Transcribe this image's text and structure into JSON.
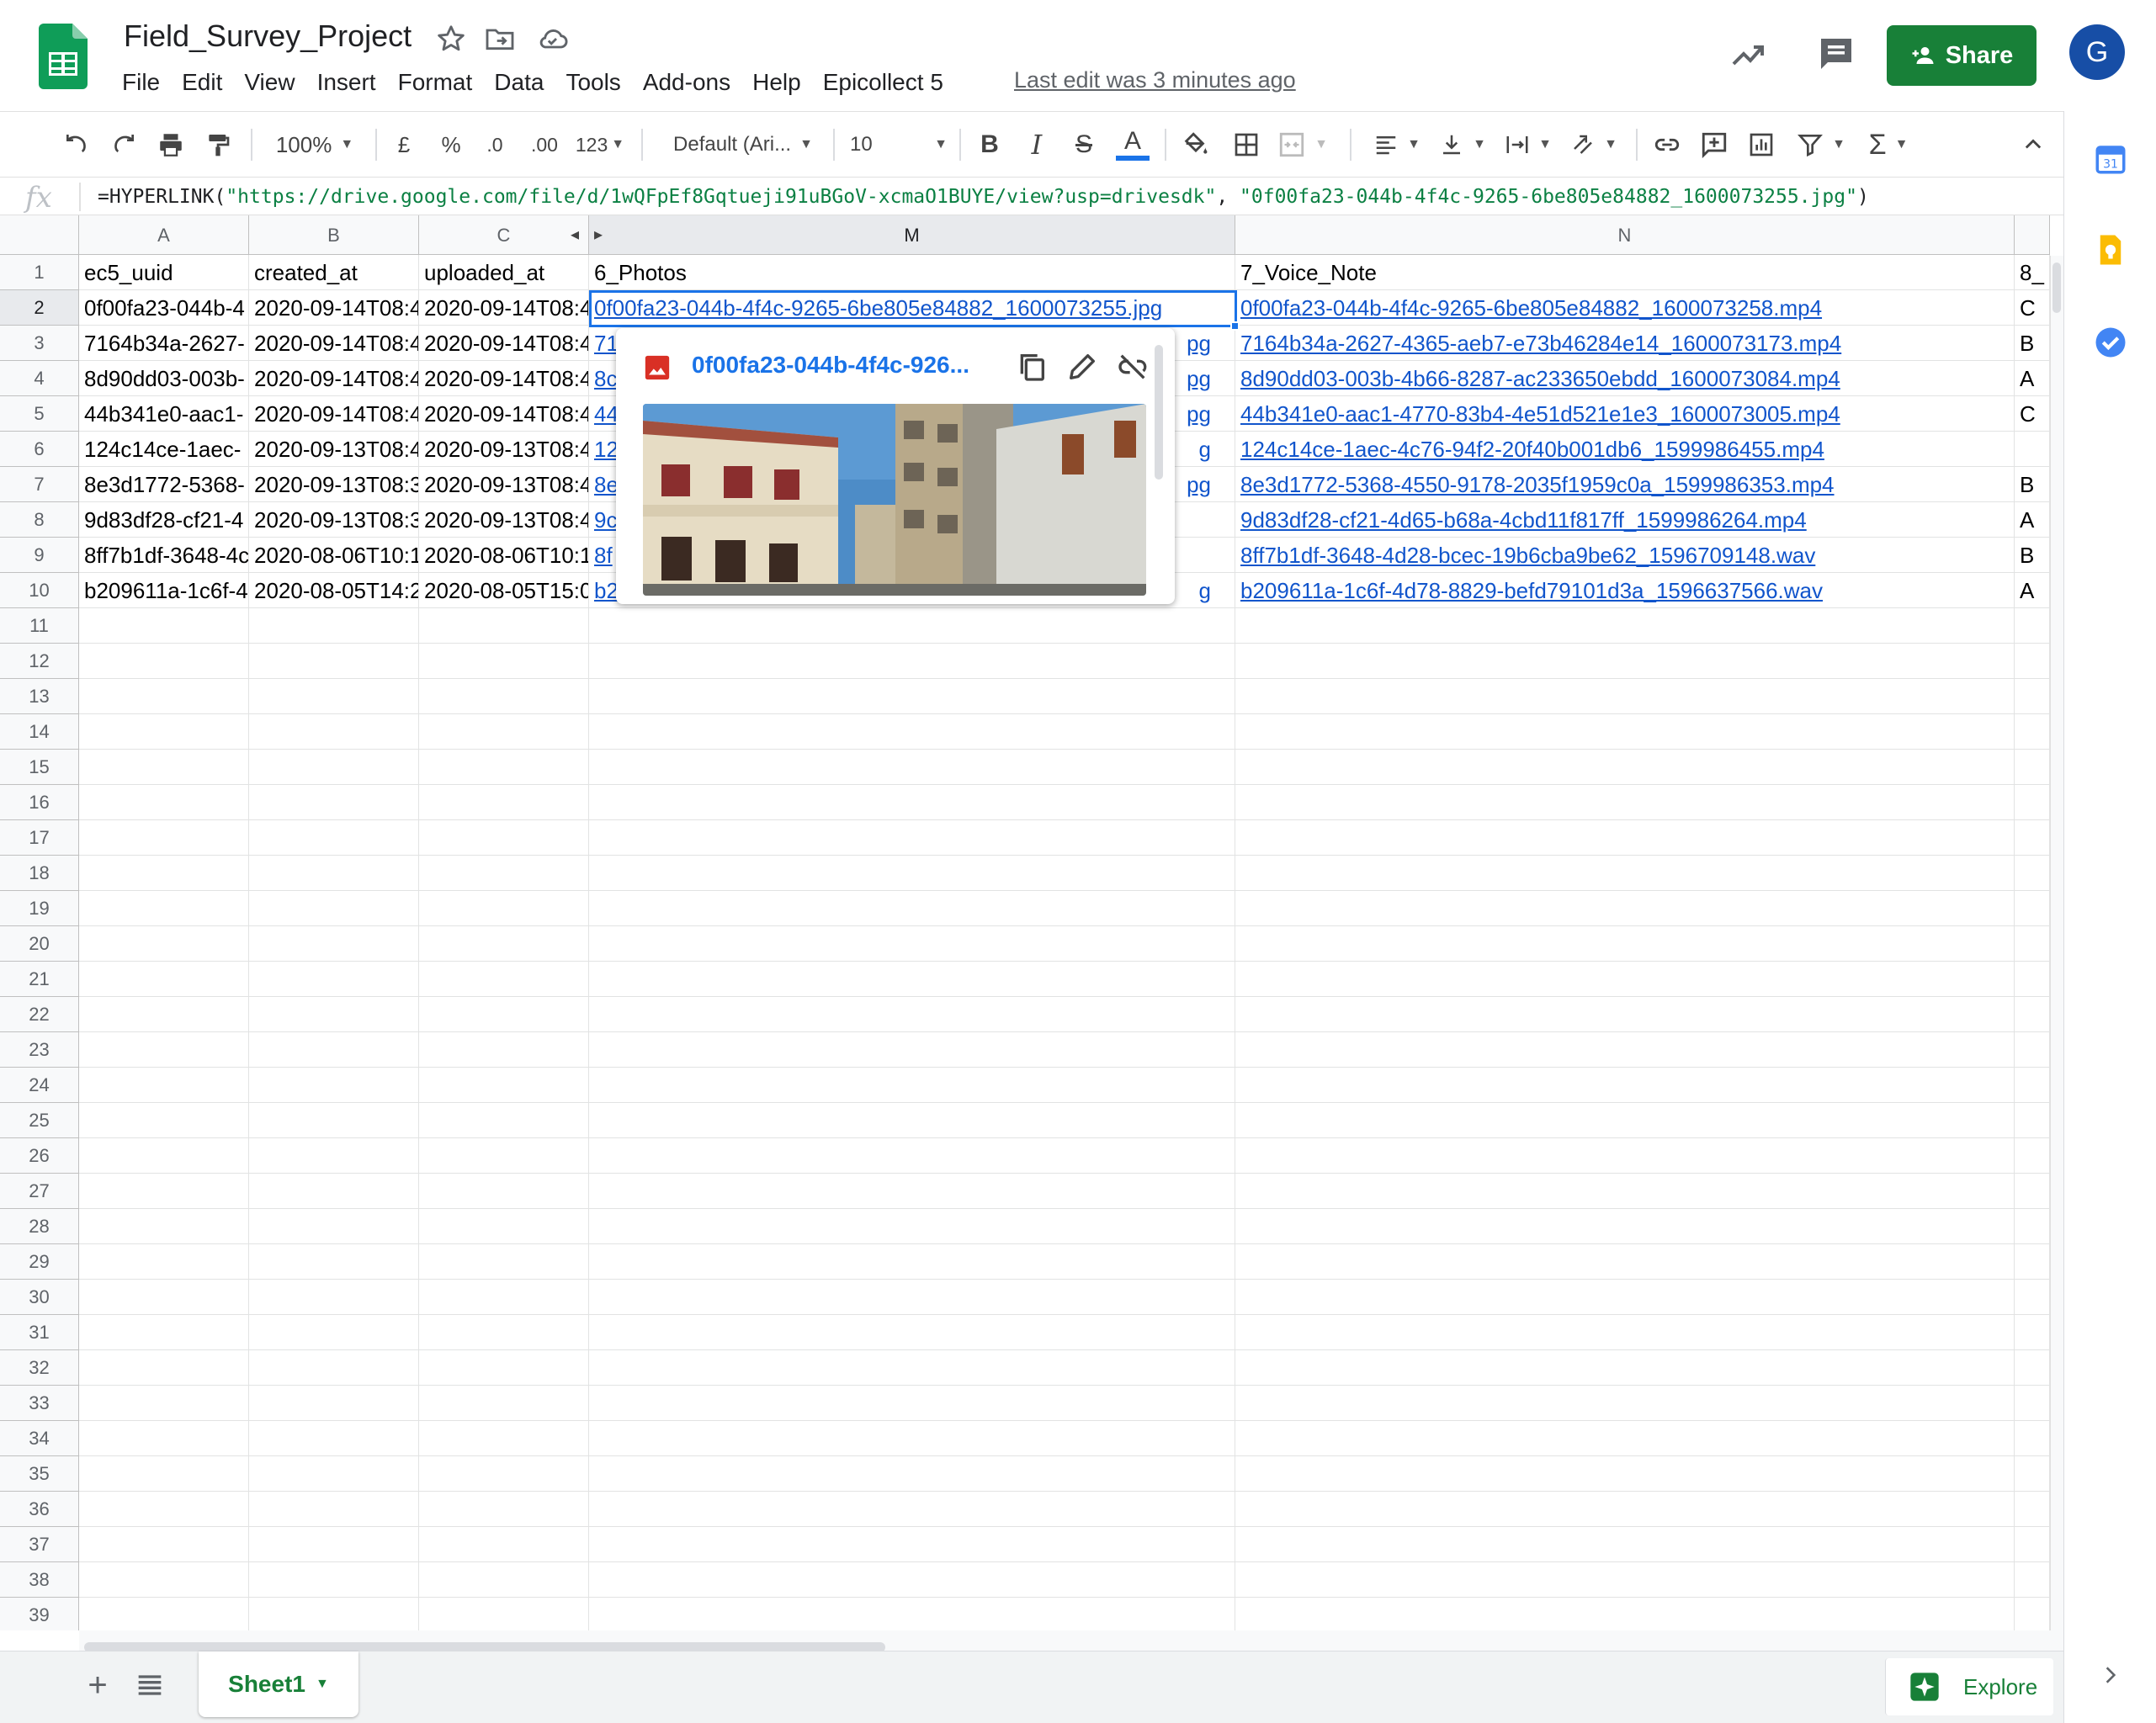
{
  "app": {
    "doc_title": "Field_Survey_Project",
    "menus": [
      "File",
      "Edit",
      "View",
      "Insert",
      "Format",
      "Data",
      "Tools",
      "Add-ons",
      "Help",
      "Epicollect 5"
    ],
    "last_edit": "Last edit was 3 minutes ago",
    "share_label": "Share",
    "avatar_letter": "G",
    "accent_color": "#188038"
  },
  "toolbar": {
    "zoom": "100%",
    "currency": "£",
    "percent": "%",
    "decrease_decimal": ".0",
    "increase_decimal": ".00",
    "more_formats": "123",
    "font_family": "Default (Ari...",
    "font_size": "10",
    "bold": "B",
    "italic": "I",
    "strikethrough": "S",
    "text_color": "A"
  },
  "formula_bar": {
    "fx": "fx",
    "prefix": "=HYPERLINK(",
    "url": "\"https://drive.google.com/file/d/1wQFpEf8Gqtueji91uBGoV-xcmaO1BUYE/view?usp=drivesdk\"",
    "separator": ", ",
    "label": "\"0f00fa23-044b-4f4c-9265-6be805e84882_1600073255.jpg\"",
    "suffix": ")"
  },
  "grid": {
    "columns": [
      "A",
      "B",
      "C",
      "M",
      "N"
    ],
    "row_numbers": [
      "1",
      "2",
      "3",
      "4",
      "5",
      "6",
      "7",
      "8",
      "9",
      "10",
      "11",
      "12",
      "13",
      "14",
      "15",
      "16",
      "17",
      "18",
      "19",
      "20",
      "21",
      "22",
      "23",
      "24",
      "25",
      "26",
      "27",
      "28",
      "29",
      "30",
      "31",
      "32",
      "33",
      "34",
      "35",
      "36",
      "37",
      "38",
      "39"
    ],
    "header_row": {
      "A": "ec5_uuid",
      "B": "created_at",
      "C": "uploaded_at",
      "M": "6_Photos",
      "N": "7_Voice_Note",
      "O": "8_"
    },
    "rows": [
      {
        "A": "0f00fa23-044b-4",
        "B": "2020-09-14T08:4",
        "C": "2020-09-14T08:4",
        "M": "0f00fa23-044b-4f4c-9265-6be805e84882_1600073255.jpg",
        "N": "0f00fa23-044b-4f4c-9265-6be805e84882_1600073258.mp4",
        "O": "C"
      },
      {
        "A": "7164b34a-2627-",
        "B": "2020-09-14T08:4",
        "C": "2020-09-14T08:4",
        "M": "71",
        "M_tail": "pg",
        "N": "7164b34a-2627-4365-aeb7-e73b46284e14_1600073173.mp4",
        "O": "B"
      },
      {
        "A": "8d90dd03-003b-",
        "B": "2020-09-14T08:4",
        "C": "2020-09-14T08:4",
        "M": "8c",
        "M_tail": "pg",
        "N": "8d90dd03-003b-4b66-8287-ac233650ebdd_1600073084.mp4",
        "O": "A"
      },
      {
        "A": "44b341e0-aac1-",
        "B": "2020-09-14T08:4",
        "C": "2020-09-14T08:4",
        "M": "44",
        "M_tail": "pg",
        "N": "44b341e0-aac1-4770-83b4-4e51d521e1e3_1600073005.mp4",
        "O": "C"
      },
      {
        "A": "124c14ce-1aec-",
        "B": "2020-09-13T08:4",
        "C": "2020-09-13T08:4",
        "M": "12",
        "M_tail": "g",
        "N": "124c14ce-1aec-4c76-94f2-20f40b001db6_1599986455.mp4",
        "O": ""
      },
      {
        "A": "8e3d1772-5368-",
        "B": "2020-09-13T08:3",
        "C": "2020-09-13T08:4",
        "M": "8e",
        "M_tail": "pg",
        "N": "8e3d1772-5368-4550-9178-2035f1959c0a_1599986353.mp4",
        "O": "B"
      },
      {
        "A": "9d83df28-cf21-4",
        "B": "2020-09-13T08:3",
        "C": "2020-09-13T08:4",
        "M": "9c",
        "M_tail": "",
        "N": "9d83df28-cf21-4d65-b68a-4cbd11f817ff_1599986264.mp4",
        "O": "A"
      },
      {
        "A": "8ff7b1df-3648-4c",
        "B": "2020-08-06T10:1",
        "C": "2020-08-06T10:1",
        "M": "8f",
        "M_tail": "",
        "N": "8ff7b1df-3648-4d28-bcec-19b6cba9be62_1596709148.wav",
        "O": "B"
      },
      {
        "A": "b209611a-1c6f-4",
        "B": "2020-08-05T14:2",
        "C": "2020-08-05T15:0",
        "M": "b2",
        "M_tail": "g",
        "N": "b209611a-1c6f-4d78-8829-befd79101d3a_1596637566.wav",
        "O": "A"
      }
    ],
    "selection_color": "#1a73e8",
    "link_color": "#1155cc"
  },
  "popup": {
    "link_text": "0f00fa23-044b-4f4c-926...",
    "copy_icon": "copy-icon",
    "edit_icon": "pencil-icon",
    "unlink_icon": "unlink-icon"
  },
  "bottom": {
    "sheet_name": "Sheet1",
    "explore_label": "Explore"
  }
}
